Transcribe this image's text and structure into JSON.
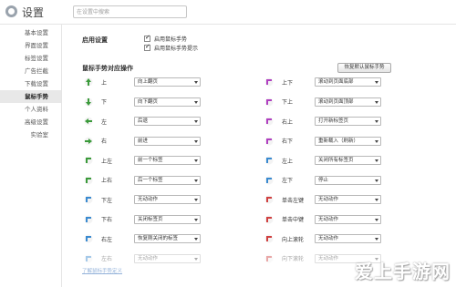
{
  "header": {
    "title": "设置",
    "search_placeholder": "在设置中搜索"
  },
  "sidebar": {
    "items": [
      {
        "label": "基本设置",
        "active": false
      },
      {
        "label": "界面设置",
        "active": false
      },
      {
        "label": "标签设置",
        "active": false
      },
      {
        "label": "广告拦截",
        "active": false
      },
      {
        "label": "下载设置",
        "active": false
      },
      {
        "label": "鼠标手势",
        "active": true
      },
      {
        "label": "个人资料",
        "active": false
      },
      {
        "label": "高级设置",
        "active": false
      },
      {
        "label": "实验室",
        "active": false
      }
    ]
  },
  "main": {
    "section1_title": "启用设置",
    "enable_gesture_label": "启用鼠标手势",
    "enable_hint_label": "启用鼠标手势提示",
    "section2_title": "鼠标手势对应操作",
    "restore_button": "恢复默认鼠标手势",
    "left_gestures": [
      {
        "label": "上",
        "action": "向上翻页",
        "icon": "arrow-up-icon",
        "color": "#3a9a3a"
      },
      {
        "label": "下",
        "action": "向下翻页",
        "icon": "arrow-down-icon",
        "color": "#3a9a3a"
      },
      {
        "label": "左",
        "action": "后退",
        "icon": "arrow-left-icon",
        "color": "#3a9a3a"
      },
      {
        "label": "右",
        "action": "前进",
        "icon": "arrow-right-icon",
        "color": "#3a9a3a"
      },
      {
        "label": "上左",
        "action": "前一个标签",
        "icon": "arrow-up-left-icon",
        "color": "#3a9a3a"
      },
      {
        "label": "上右",
        "action": "后一个标签",
        "icon": "arrow-up-right-icon",
        "color": "#3a9a3a"
      },
      {
        "label": "下左",
        "action": "无动动作",
        "icon": "arrow-down-left-icon",
        "color": "#3a8ad0"
      },
      {
        "label": "下右",
        "action": "关闭标签页",
        "icon": "arrow-down-right-icon",
        "color": "#3a8ad0"
      },
      {
        "label": "右左",
        "action": "恢复刚关闭的标签",
        "icon": "arrow-right-left-icon",
        "color": "#3a8ad0"
      },
      {
        "label": "左右",
        "action": "无动动作",
        "icon": "arrow-left-right-icon",
        "color": "#3a8ad0"
      }
    ],
    "right_gestures": [
      {
        "label": "上下",
        "action": "滚动到页面底部",
        "icon": "arrow-up-down-icon",
        "color": "#b040c0"
      },
      {
        "label": "下上",
        "action": "滚动到页面顶部",
        "icon": "arrow-down-up-icon",
        "color": "#b040c0"
      },
      {
        "label": "右上",
        "action": "打开新标签页",
        "icon": "arrow-right-up-icon",
        "color": "#b040c0"
      },
      {
        "label": "右下",
        "action": "重新载入（刷新）",
        "icon": "arrow-right-down-icon",
        "color": "#b040c0"
      },
      {
        "label": "左上",
        "action": "关闭所有标签页",
        "icon": "arrow-left-up-icon",
        "color": "#3a8ad0"
      },
      {
        "label": "左下",
        "action": "停止",
        "icon": "arrow-left-down-icon",
        "color": "#3a8ad0"
      },
      {
        "label": "单击左键",
        "action": "无动动作",
        "icon": "left-click-icon",
        "color": "#d04040"
      },
      {
        "label": "单击中键",
        "action": "无动动作",
        "icon": "middle-click-icon",
        "color": "#d04040"
      },
      {
        "label": "向上滚轮",
        "action": "无动动作",
        "icon": "wheel-up-icon",
        "color": "#d04040"
      },
      {
        "label": "向下滚轮",
        "action": "无动动作",
        "icon": "wheel-down-icon",
        "color": "#d04040"
      }
    ]
  },
  "footer_link": "了解鼠标手势定义",
  "watermark": "爱上手游网"
}
